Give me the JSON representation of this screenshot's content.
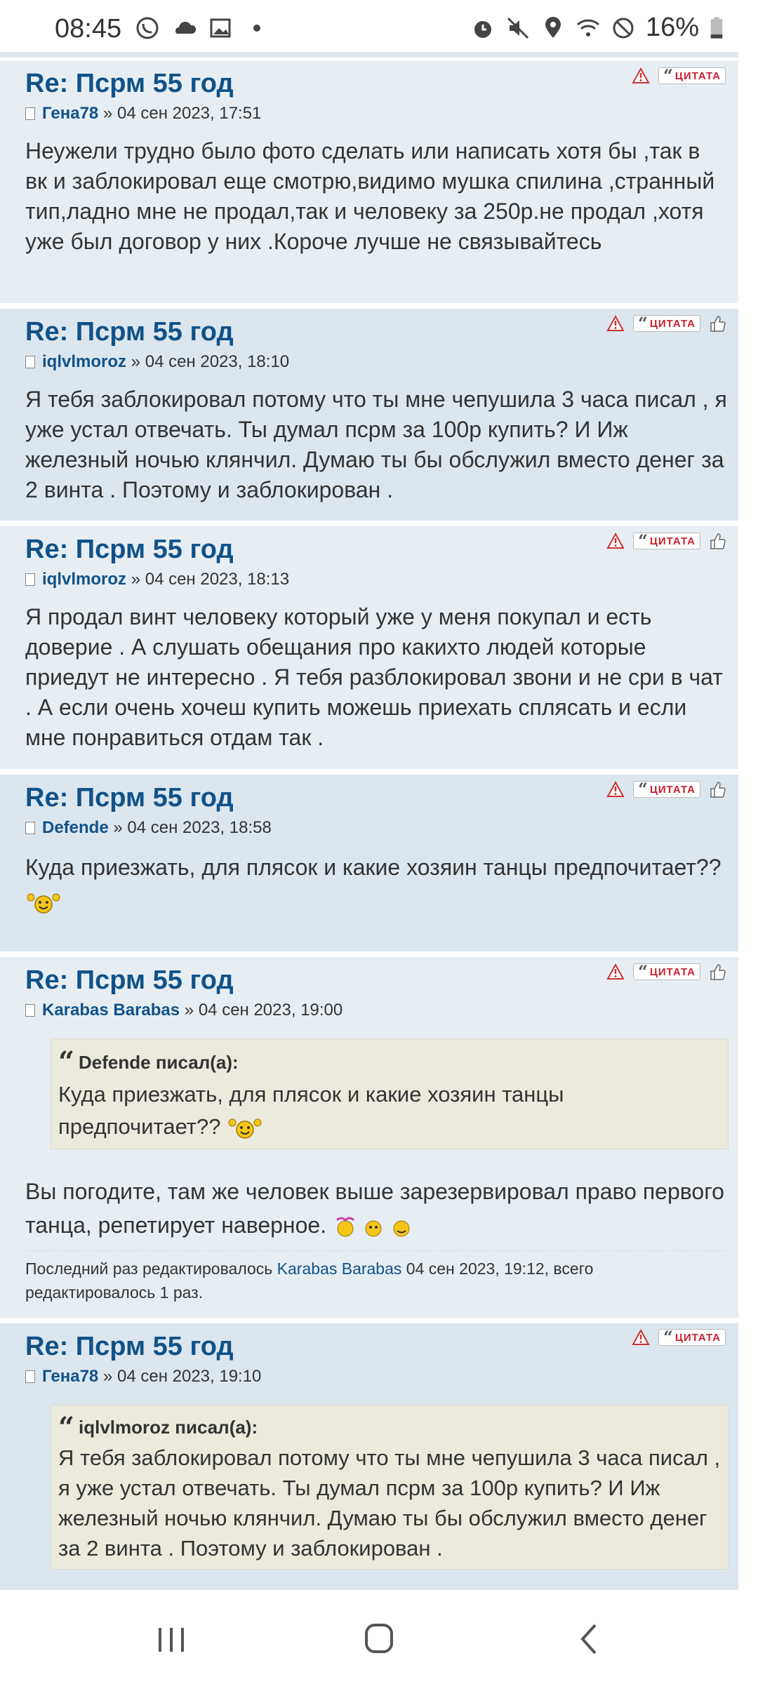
{
  "status_bar": {
    "time": "08:45",
    "battery": "16%",
    "icons_left": [
      "viber-icon",
      "cloud-icon",
      "image-icon",
      "dot-icon"
    ],
    "icons_right": [
      "alarm-icon",
      "mute-icon",
      "location-icon",
      "wifi-icon",
      "block-icon",
      "battery-icon"
    ]
  },
  "posts": [
    {
      "title": "Re: Псрм 55 год",
      "author": "Гена78",
      "sep": "»",
      "date": "04 сен 2023, 17:51",
      "content": "Неужели трудно было фото сделать или написать хотя бы ,так в вк и заблокировал еще смотрю,видимо мушка спилина ,странный тип,ладно мне не продал,так и человеку за 250р.не продал ,хотя уже был договор у них .Короче лучше не связывайтесь"
    },
    {
      "title": "Re: Псрм 55 год",
      "author": "iqlvlmoroz",
      "sep": "»",
      "date": "04 сен 2023, 18:10",
      "content": "Я тебя заблокировал потому что ты мне чепушила 3 часа писал , я уже устал отвечать. Ты думал псрм за 100р купить? И Иж железный ночью клянчил. Думаю ты бы обслужил вместо денег за 2 винта . Поэтому и заблокирован ."
    },
    {
      "title": "Re: Псрм 55 год",
      "author": "iqlvlmoroz",
      "sep": "»",
      "date": "04 сен 2023, 18:13",
      "content": "Я продал винт человеку который уже у меня покупал и есть доверие . А слушать обещания про какихто людей которые приедут не интересно . Я тебя разблокировал звони и не сри в чат . А если очень хочеш купить можешь приехать сплясать и если мне понравиться отдам так ."
    },
    {
      "title": "Re: Псрм 55 год",
      "author": "Defende",
      "sep": "»",
      "date": "04 сен 2023, 18:58",
      "content": "Куда приезжать, для плясок и какие хозяин танцы предпочитает??"
    },
    {
      "title": "Re: Псрм 55 год",
      "author": "Karabas Barabas",
      "sep": "»",
      "date": "04 сен 2023, 19:00",
      "quote_cite": "Defende писал(а):",
      "quote_text": "Куда приезжать, для плясок и какие хозяин танцы предпочитает??",
      "content": "Вы погодите, там же человек выше зарезервировал право первого танца, репетирует наверное.",
      "edit_prefix": "Последний раз редактировалось",
      "edit_author": "Karabas Barabas",
      "edit_suffix": "04 сен 2023, 19:12, всего редактировалось 1 раз."
    },
    {
      "title": "Re: Псрм 55 год",
      "author": "Гена78",
      "sep": "»",
      "date": "04 сен 2023, 19:10",
      "quote_cite": "iqlvlmoroz писал(а):",
      "quote_text": "Я тебя заблокировал потому что ты мне чепушила 3 часа писал , я уже устал отвечать. Ты думал псрм за 100р купить? И Иж железный ночью клянчил. Думаю ты бы обслужил вместо денег за 2 винта . Поэтому и заблокирован ."
    }
  ],
  "buttons": {
    "quote": "ЦИТАТА"
  },
  "nav": {
    "icons": [
      "recent-apps-icon",
      "home-icon",
      "back-icon"
    ]
  }
}
